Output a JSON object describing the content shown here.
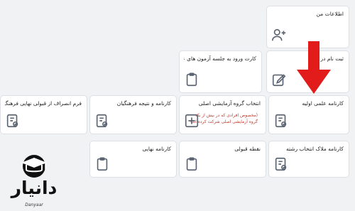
{
  "cards": {
    "profile": {
      "title": "اطلاعات من"
    },
    "exam_card": {
      "title": "کارت ورود به جلسه آزمون های عملی"
    },
    "register": {
      "title": "ثبت نام در"
    },
    "withdraw": {
      "title": "فرم انصراف از قبولی نهایی فرهنگیان"
    },
    "cultural_report": {
      "title": "کارنامه و نتیجه فرهنگیان"
    },
    "select_group": {
      "title": "انتخاب گروه آزمایشی اصلی",
      "note": "(مخصوص افرادی که در بیش از یک گروه آزمایشی اصلی شرکت کرده اند)"
    },
    "scientific_report": {
      "title": "کارنامه علمی اولیه"
    },
    "final_report": {
      "title": "کارنامه نهایی"
    },
    "acceptance": {
      "title": "نقطه قبولی"
    },
    "major_report": {
      "title": "کارنامه ملاک انتخاب رشته"
    }
  },
  "logo": {
    "fa": "دانیار",
    "en": "Danyaar"
  },
  "colors": {
    "arrow": "#e21b1b",
    "icon": "#5b6472",
    "accent": "#c0392b"
  }
}
